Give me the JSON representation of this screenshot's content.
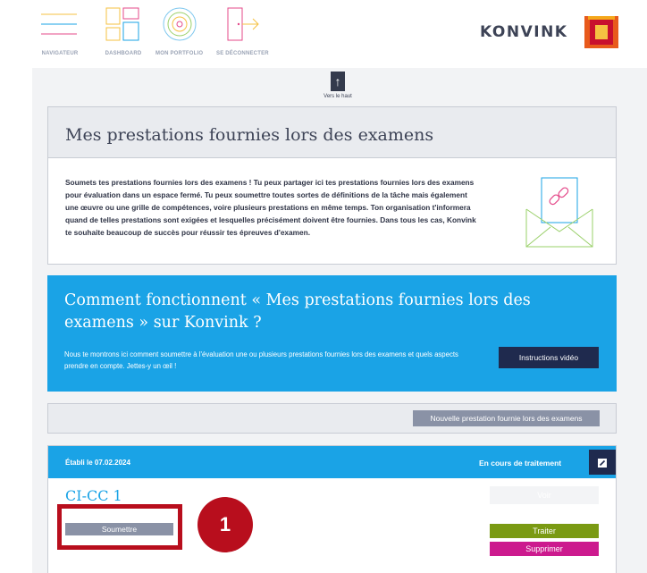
{
  "topnav": {
    "items": [
      {
        "label": "NAVIGATEUR",
        "icon": "hamburger-icon"
      },
      {
        "label": "DASHBOARD",
        "icon": "dashboard-icon"
      },
      {
        "label": "MON PORTFOLIO",
        "icon": "portfolio-icon"
      },
      {
        "label": "SE DÉCONNECTER",
        "icon": "logout-icon"
      }
    ],
    "brand": "KONVINK"
  },
  "scroll_top": {
    "label": "Vers le haut",
    "icon": "arrow-up-icon"
  },
  "intro": {
    "title": "Mes prestations fournies lors des examens",
    "text": "Soumets tes prestations fournies lors des examens ! Tu peux partager ici tes prestations fournies lors des examens pour évaluation dans un espace fermé. Tu peux soumettre toutes sortes de définitions de la tâche mais également une œuvre ou une grille de compétences, voire plusieurs prestations en même temps. Ton organisation t'informera quand de telles prestations sont exigées et lesquelles précisément doivent être fournies. Dans tous les cas, Konvink te souhaite beaucoup de succès pour réussir tes épreuves d'examen.",
    "icon": "envelope-link-icon"
  },
  "howto": {
    "title": "Comment fonctionnent « Mes prestations fournies lors des examens » sur Konvink ?",
    "text": "Nous te montrons ici comment soumettre à l'évaluation une ou plusieurs prestations fournies lors des examens et quels aspects prendre en compte. Jettes-y un œil !",
    "button": "Instructions vidéo"
  },
  "toolbar": {
    "new_button": "Nouvelle prestation fournie lors des examens"
  },
  "card": {
    "date": "Établi le 07.02.2024",
    "status": "En cours de traitement",
    "edit_icon": "pencil-icon",
    "title": "CI-CC 1",
    "submit": "Soumettre",
    "view": "Voir",
    "process": "Traiter",
    "delete": "Supprimer"
  },
  "annotation": {
    "number": "1"
  },
  "colors": {
    "accent_blue": "#1aa3e6",
    "navy": "#1f2a4e",
    "green": "#7a9a13",
    "magenta": "#cc1a8e",
    "highlight_red": "#b80e1d",
    "text_dark": "#3d4356"
  }
}
